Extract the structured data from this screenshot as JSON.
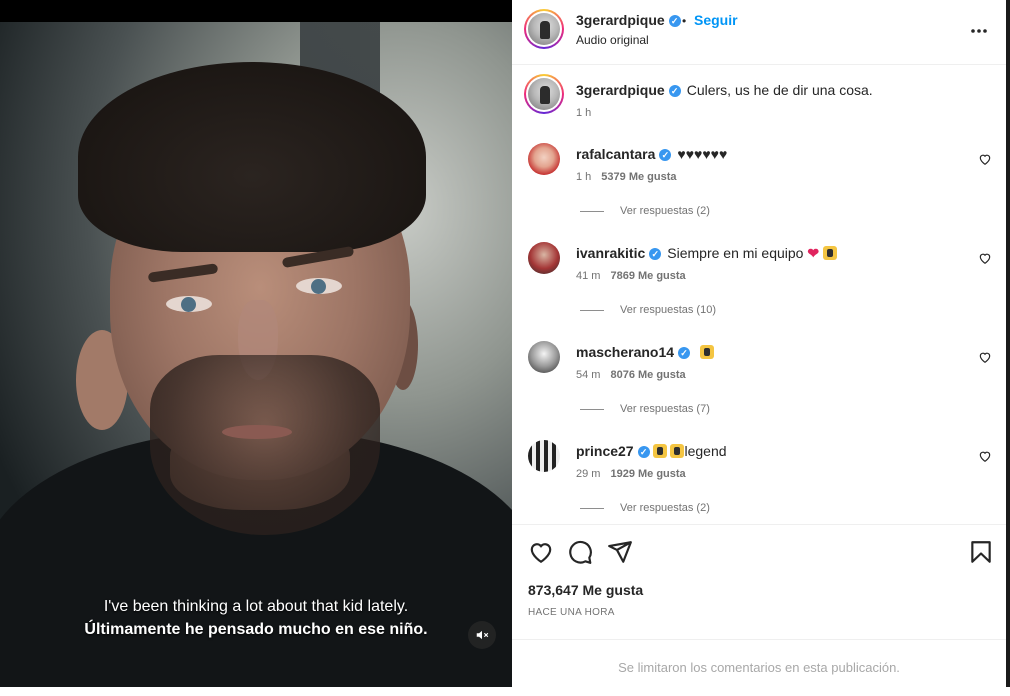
{
  "video": {
    "subtitle_en": "I've been thinking a lot about that kid lately.",
    "subtitle_es": "Últimamente he pensado mucho en ese niño.",
    "mute_icon": "speaker-muted-icon"
  },
  "header": {
    "username": "3gerardpique",
    "follow_label": "Seguir",
    "audio_label": "Audio original",
    "separator": "•",
    "more_label": "•••"
  },
  "caption": {
    "username": "3gerardpique",
    "text": "Culers, us he de dir una cosa.",
    "time": "1 h"
  },
  "comments": [
    {
      "username": "rafalcantara",
      "text": "♥♥♥♥♥♥",
      "time": "1 h",
      "likes": "5379 Me gusta",
      "replies": "Ver respuestas (2)"
    },
    {
      "username": "ivanrakitic",
      "text": "Siempre en mi equipo",
      "emoji": "❤",
      "time": "41 m",
      "likes": "7869 Me gusta",
      "replies": "Ver respuestas (10)"
    },
    {
      "username": "mascherano14",
      "text": "",
      "time": "54 m",
      "likes": "8076 Me gusta",
      "replies": "Ver respuestas (7)"
    },
    {
      "username": "prince27",
      "text": "legend",
      "time": "29 m",
      "likes": "1929 Me gusta",
      "replies": "Ver respuestas (2)"
    }
  ],
  "actions": {
    "likes": "873,647 Me gusta",
    "time": "HACE UNA HORA",
    "icons": [
      "heart-icon",
      "comment-icon",
      "share-icon",
      "bookmark-icon"
    ]
  },
  "footer": {
    "limited_comments": "Se limitaron los comentarios en esta publicación."
  },
  "colors": {
    "accent": "#0095f6",
    "verified": "#3897f0",
    "muted_text": "#737373"
  }
}
